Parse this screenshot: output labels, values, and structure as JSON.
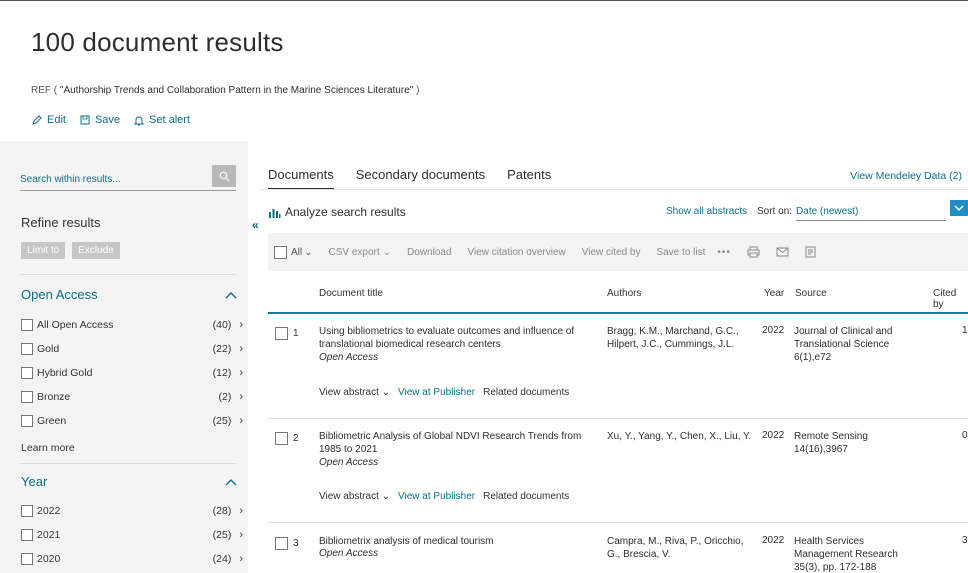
{
  "header": {
    "title": "100 document results",
    "query_prefix": "REF (",
    "query_text": "\"Authorship Trends and Collaboration Pattern in the Marine Sciences Literature\"",
    "query_suffix": ")",
    "actions": [
      {
        "label": "Edit",
        "icon": "pencil-icon"
      },
      {
        "label": "Save",
        "icon": "save-icon"
      },
      {
        "label": "Set alert",
        "icon": "bell-icon"
      }
    ]
  },
  "sidebar": {
    "search_placeholder": "Search within results...",
    "refine_title": "Refine results",
    "limit_to": "Limit to",
    "exclude": "Exclude",
    "open_access": {
      "title": "Open Access",
      "items": [
        {
          "label": "All Open Access",
          "count": "(40)"
        },
        {
          "label": "Gold",
          "count": "(22)"
        },
        {
          "label": "Hybrid Gold",
          "count": "(12)"
        },
        {
          "label": "Bronze",
          "count": "(2)"
        },
        {
          "label": "Green",
          "count": "(25)"
        }
      ],
      "learn_more": "Learn more"
    },
    "year": {
      "title": "Year",
      "items": [
        {
          "label": "2022",
          "count": "(28)"
        },
        {
          "label": "2021",
          "count": "(25)"
        },
        {
          "label": "2020",
          "count": "(24)"
        }
      ]
    }
  },
  "main": {
    "tabs": [
      {
        "label": "Documents",
        "active": true
      },
      {
        "label": "Secondary documents",
        "active": false
      },
      {
        "label": "Patents",
        "active": false
      }
    ],
    "mendeley": "View Mendeley Data (2)",
    "analyze": "Analyze search results",
    "show_all_abstracts": "Show all abstracts",
    "sort_label": "Sort on:",
    "sort_value": "Date (newest)",
    "toolbar": {
      "all": "All",
      "csv_export": "CSV export",
      "download": "Download",
      "citation_overview": "View citation overview",
      "cited_by": "View cited by",
      "save_to_list": "Save to list",
      "more": "•••"
    },
    "columns": {
      "title": "Document title",
      "authors": "Authors",
      "year": "Year",
      "source": "Source",
      "cited": "Cited by"
    },
    "links": {
      "view_abstract": "View abstract",
      "view_publisher": "View at Publisher",
      "related": "Related documents"
    },
    "rows": [
      {
        "num": "1",
        "title": "Using bibliometrics to evaluate outcomes and influence of translational biomedical research centers",
        "access": "Open Access",
        "authors": "Bragg, K.M., Marchand, G.C., Hilpert, J.C., Cummings, J.L.",
        "year": "2022",
        "source": "Journal of Clinical and Translational Science 6(1),e72",
        "cited": "1"
      },
      {
        "num": "2",
        "title": "Bibliometric Analysis of Global NDVI Research Trends from 1985 to 2021",
        "access": "Open Access",
        "authors": "Xu, Y., Yang, Y., Chen, X., Liu, Y.",
        "year": "2022",
        "source": "Remote Sensing 14(16),3967",
        "cited": "0"
      },
      {
        "num": "3",
        "title": "Bibliometrix analysis of medical tourism",
        "access": "Open Access",
        "authors": "Campra, M., Riva, P., Oricchio, G., Brescia, V.",
        "year": "2022",
        "source": "Health Services Management Research 35(3), pp. 172-188",
        "cited": "3"
      }
    ]
  }
}
